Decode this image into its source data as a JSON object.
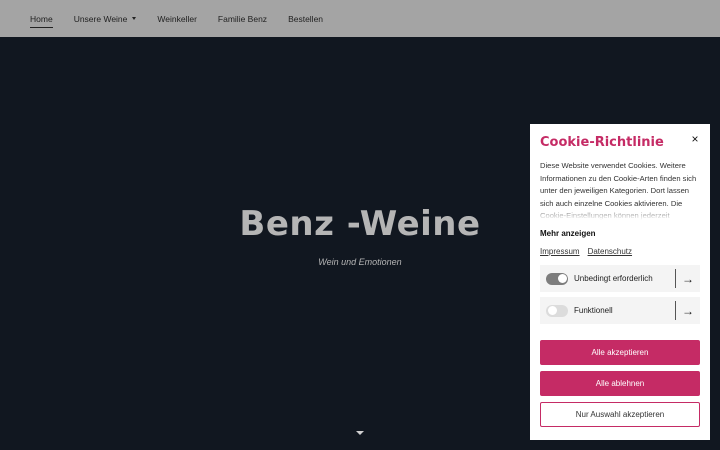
{
  "nav": {
    "items": [
      {
        "label": "Home"
      },
      {
        "label": "Unsere Weine"
      },
      {
        "label": "Weinkeller"
      },
      {
        "label": "Familie Benz"
      },
      {
        "label": "Bestellen"
      }
    ]
  },
  "hero": {
    "title": "Benz -Weine",
    "subtitle": "Wein und Emotionen"
  },
  "cookie": {
    "title": "Cookie-Richtlinie",
    "close_icon": "×",
    "text": "Diese Website verwendet Cookies. Weitere Informationen zu den Cookie-Arten finden sich unter den jeweiligen Kategorien. Dort lassen sich auch einzelne Cookies aktivieren. Die Cookie-Einstellungen können jederzeit",
    "more_label": "Mehr anzeigen",
    "links": {
      "impressum": "Impressum",
      "datenschutz": "Datenschutz"
    },
    "categories": [
      {
        "label": "Unbedingt erforderlich",
        "enabled": true
      },
      {
        "label": "Funktionell",
        "enabled": false
      }
    ],
    "arrow_icon": "→",
    "buttons": {
      "accept_all": "Alle akzeptieren",
      "reject_all": "Alle ablehnen",
      "accept_selection": "Nur Auswahl akzeptieren"
    },
    "accent_color": "#c52b65"
  }
}
